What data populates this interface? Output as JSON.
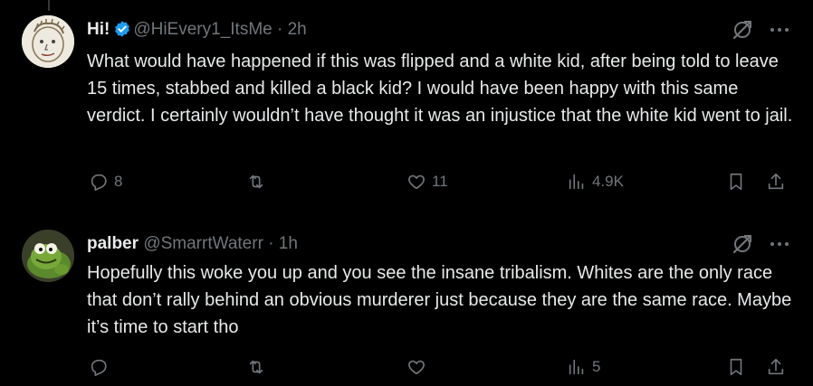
{
  "tweets": [
    {
      "display_name": "Hi!",
      "handle": "@HiEvery1_ItsMe",
      "time": "· 2h",
      "text": "What would have happened if this was flipped and a white kid, after being told to leave 15 times, stabbed and killed a black kid?  I would have been happy with this same verdict.  I certainly wouldn’t have thought it was an injustice that the white kid went to jail.",
      "verified": true,
      "replies": "8",
      "retweets": "",
      "likes": "11",
      "views": "4.9K",
      "avatar_icon": "doodle-face-avatar"
    },
    {
      "display_name": "palber",
      "handle": "@SmarrtWaterr",
      "time": "· 1h",
      "text": "Hopefully this woke you up and you see the insane tribalism. Whites are the only race that don’t rally behind an obvious murderer just because they are the same race.  Maybe it’s time to start tho",
      "verified": false,
      "replies": "",
      "retweets": "",
      "likes": "",
      "views": "5",
      "avatar_icon": "kermit-avatar"
    }
  ],
  "colors": {
    "background": "#000000",
    "text": "#e7e9ea",
    "muted": "#71767b",
    "verified": "#1d9bf0"
  }
}
